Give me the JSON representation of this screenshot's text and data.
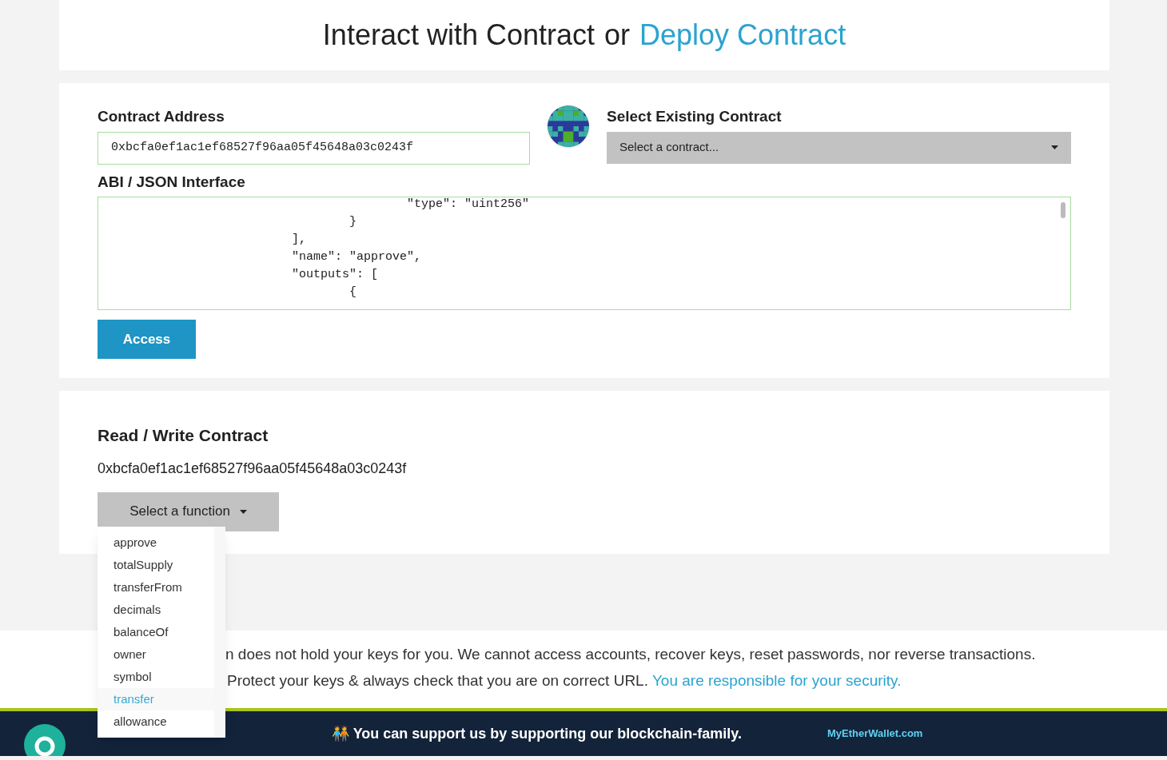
{
  "header": {
    "title": "Interact with Contract",
    "separator": "or",
    "link": "Deploy Contract"
  },
  "access_panel": {
    "address_label": "Contract Address",
    "address_value": "0xbcfa0ef1ac1ef68527f96aa05f45648a03c0243f",
    "select_label": "Select Existing Contract",
    "select_placeholder": "Select a contract...",
    "abi_label": "ABI / JSON Interface",
    "abi_lines": [
      "                        \"type\": \"uint256\"",
      "                }",
      "        ],",
      "        \"name\": \"approve\",",
      "        \"outputs\": [",
      "                {"
    ],
    "access_button": "Access"
  },
  "read_write": {
    "title": "Read / Write Contract",
    "address": "0xbcfa0ef1ac1ef68527f96aa05f45648a03c0243f",
    "function_button": "Select a function",
    "functions": [
      {
        "label": "approve",
        "selected": false
      },
      {
        "label": "totalSupply",
        "selected": false
      },
      {
        "label": "transferFrom",
        "selected": false
      },
      {
        "label": "decimals",
        "selected": false
      },
      {
        "label": "balanceOf",
        "selected": false
      },
      {
        "label": "owner",
        "selected": false
      },
      {
        "label": "symbol",
        "selected": false
      },
      {
        "label": "transfer",
        "selected": true
      },
      {
        "label": "allowance",
        "selected": false
      }
    ]
  },
  "notice": {
    "line_1": "n does not hold your keys for you. We cannot access accounts, recover keys, reset passwords, nor reverse transactions.",
    "line_2": "Protect your keys & always check that you are on correct URL.",
    "link": "You are responsible for your security."
  },
  "footer": {
    "support": "🧑‍🤝‍🧑 You can support us by supporting our blockchain-family.",
    "link": "MyEtherWallet.com"
  }
}
